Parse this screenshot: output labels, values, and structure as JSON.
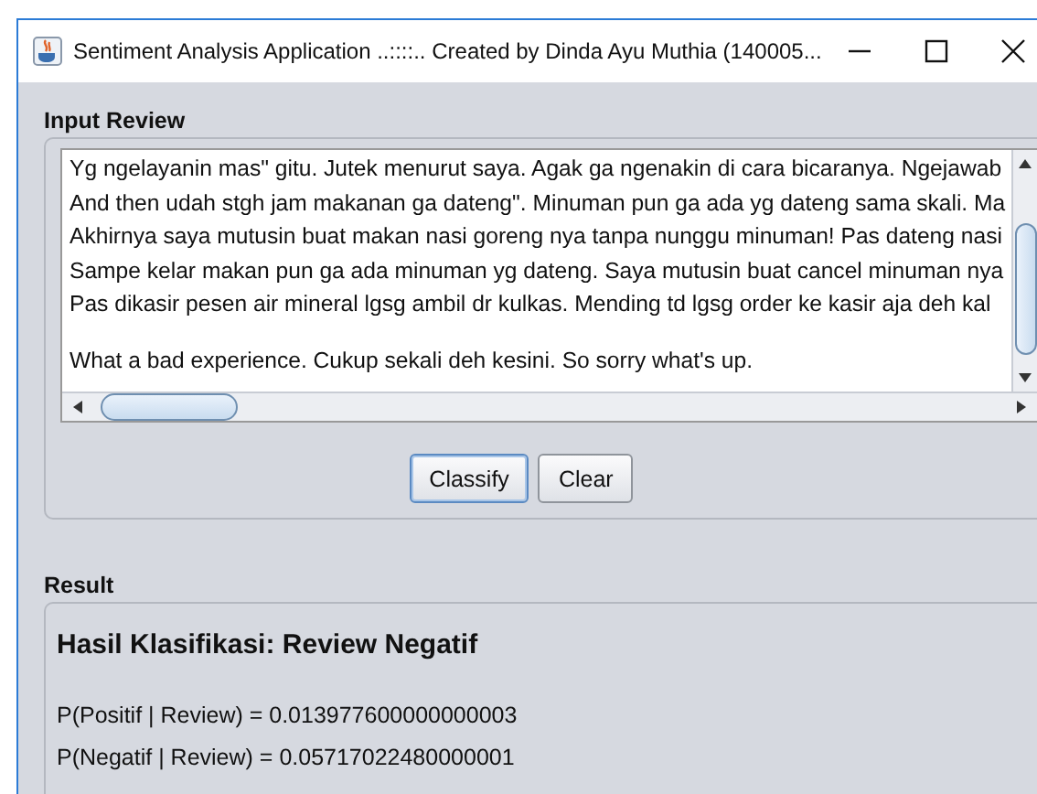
{
  "window": {
    "title": "Sentiment Analysis Application ..::::.. Created by Dinda Ayu Muthia (140005..."
  },
  "input_review": {
    "label": "Input Review",
    "paragraphs": [
      {
        "lines": [
          "Yg ngelayanin mas\" gitu. Jutek menurut saya. Agak ga ngenakin di cara bicaranya. Ngejawab",
          "And then udah stgh jam makanan ga dateng\". Minuman pun ga ada yg dateng sama skali. Ma",
          "Akhirnya saya mutusin buat makan nasi goreng nya tanpa nunggu minuman! Pas dateng nasi",
          "Sampe kelar makan pun ga ada minuman yg dateng. Saya mutusin buat cancel minuman nya",
          "Pas dikasir pesen air mineral lgsg ambil dr kulkas. Mending td lgsg order ke kasir aja deh kal"
        ]
      },
      {
        "lines": [
          "What a bad experience. Cukup sekali deh kesini. So sorry what's up."
        ]
      }
    ]
  },
  "buttons": [
    {
      "label": "Classify",
      "focused": true
    },
    {
      "label": "Clear",
      "focused": false
    }
  ],
  "result": {
    "label": "Result",
    "heading": "Hasil Klasifikasi: Review Negatif",
    "probabilities": [
      "P(Positif | Review) = 0.013977600000000003",
      "P(Negatif | Review) = 0.05717022480000001"
    ]
  }
}
